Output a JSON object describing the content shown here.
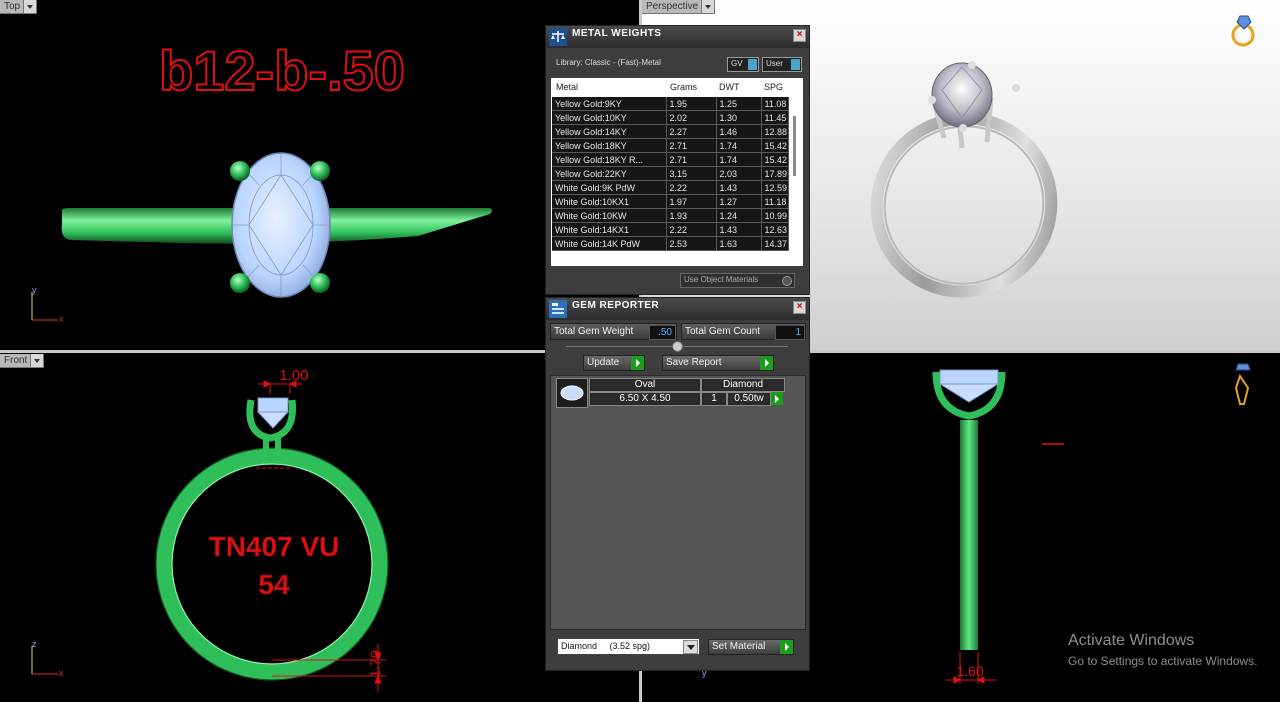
{
  "viewports": {
    "top": {
      "label": "Top",
      "model_title": "b12-b-.50",
      "axis_v": "y",
      "axis_h": "x"
    },
    "perspective": {
      "label": "Perspective"
    },
    "front": {
      "label": "Front",
      "text_line1": "TN407 VU",
      "text_line2": "54",
      "dim_top": "1.00",
      "dim_bottom": "1.70",
      "axis_v": "z",
      "axis_h": "x"
    },
    "right": {
      "dim_bottom": "1.60",
      "axis_v": "y"
    }
  },
  "metal_weights": {
    "title": "METAL WEIGHTS",
    "library": "Library: Classic - (Fast)-Metal",
    "gv_label": "GV",
    "user_label": "User",
    "columns": [
      "Metal",
      "Grams",
      "DWT",
      "SPG"
    ],
    "rows": [
      [
        "Yellow Gold:9KY",
        "1.95",
        "1.25",
        "11.08"
      ],
      [
        "Yellow Gold:10KY",
        "2.02",
        "1.30",
        "11.45"
      ],
      [
        "Yellow Gold:14KY",
        "2.27",
        "1.46",
        "12.88"
      ],
      [
        "Yellow Gold:18KY",
        "2.71",
        "1.74",
        "15.42"
      ],
      [
        "Yellow Gold:18KY R...",
        "2.71",
        "1.74",
        "15.42"
      ],
      [
        "Yellow Gold:22KY",
        "3.15",
        "2.03",
        "17.89"
      ],
      [
        "White Gold:9K PdW",
        "2.22",
        "1.43",
        "12.59"
      ],
      [
        "White Gold:10KX1",
        "1.97",
        "1.27",
        "11.18"
      ],
      [
        "White Gold:10KW",
        "1.93",
        "1.24",
        "10.99"
      ],
      [
        "White Gold:14KX1",
        "2.22",
        "1.43",
        "12.63"
      ],
      [
        "White Gold:14K PdW",
        "2.53",
        "1.63",
        "14.37"
      ]
    ],
    "use_object_materials": "Use Object Materials"
  },
  "gem_reporter": {
    "title": "GEM REPORTER",
    "total_weight_label": "Total Gem Weight",
    "total_weight_value": ".50",
    "total_count_label": "Total Gem Count",
    "total_count_value": "1",
    "update_label": "Update",
    "save_report_label": "Save Report",
    "gem": {
      "shape": "Oval",
      "material": "Diamond",
      "size": "6.50 X 4.50",
      "count": "1",
      "weight": "0.50tw"
    },
    "material_select": "Diamond     (3.52 spg)",
    "set_material_label": "Set Material"
  },
  "watermark": {
    "line1": "Activate Windows",
    "line2": "Go to Settings to activate Windows."
  },
  "colors": {
    "ring_green": "#2fbf5a",
    "dimension_red": "#e01010",
    "gem_blue": "#b9d4ff",
    "panel": "#3d3d3d"
  }
}
